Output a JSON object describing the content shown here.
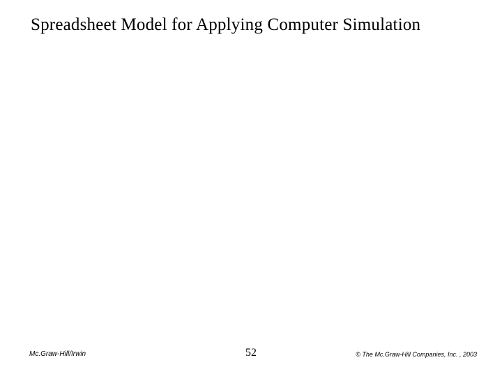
{
  "slide": {
    "title": "Spreadsheet Model for Applying Computer Simulation",
    "footer": {
      "left": "Mc.Graw-Hill/Irwin",
      "center": "52",
      "right": "© The Mc.Graw-Hill Companies, Inc. , 2003"
    }
  }
}
